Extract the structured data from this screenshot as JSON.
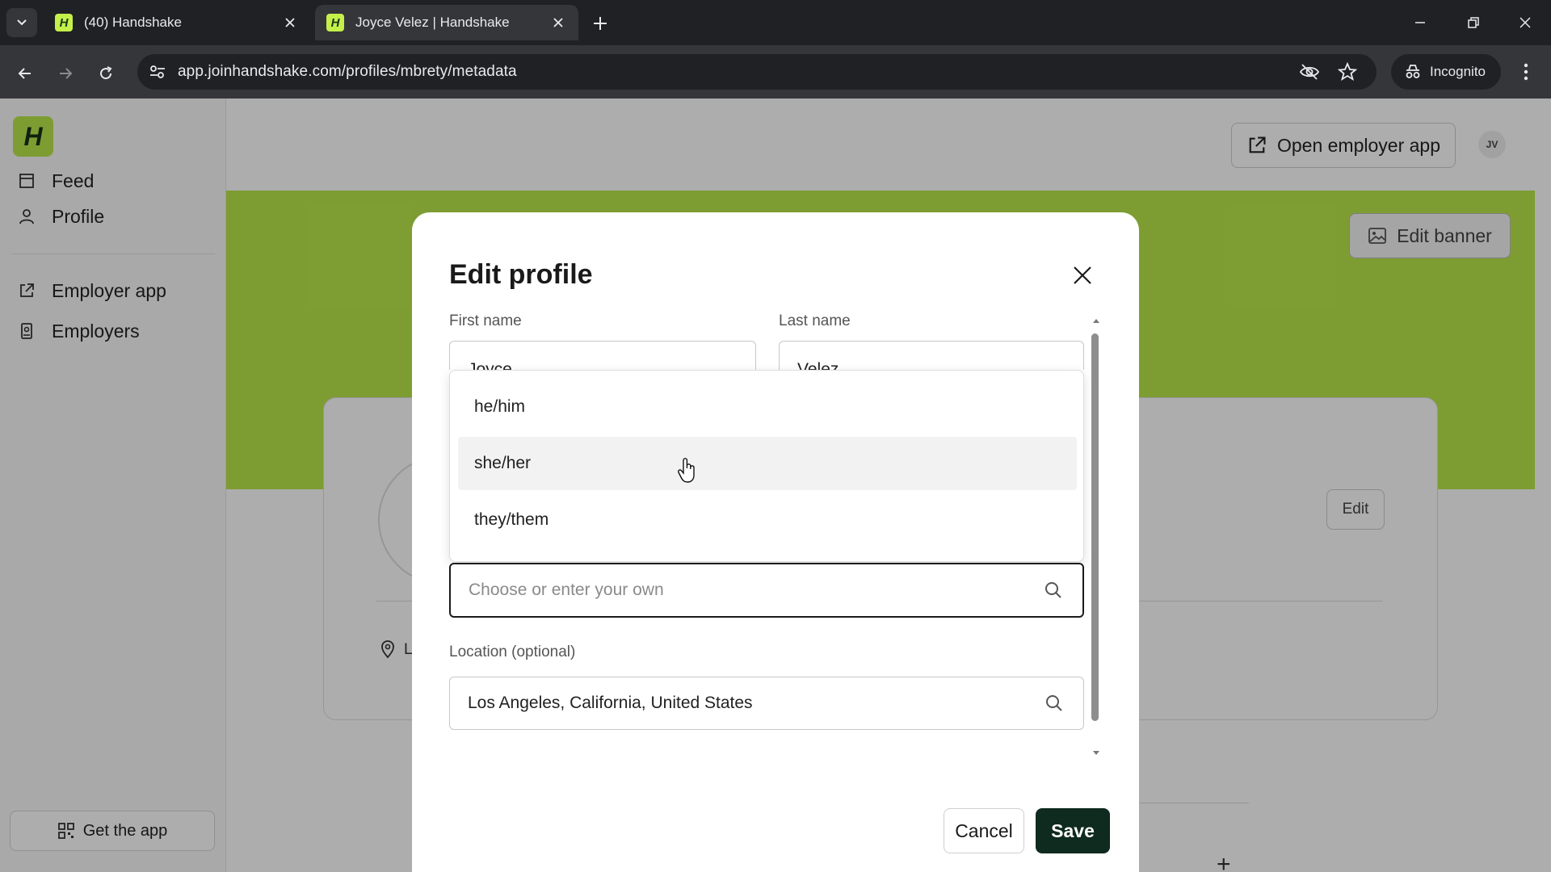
{
  "browser": {
    "tabs": [
      {
        "title": "(40) Handshake",
        "favicon": "H",
        "active": false
      },
      {
        "title": "Joyce Velez | Handshake",
        "favicon": "H",
        "active": true
      }
    ],
    "url": "app.joinhandshake.com/profiles/mbrety/metadata",
    "incognito_label": "Incognito",
    "colors": {
      "frame": "#202124",
      "toolbar": "#35363a",
      "text": "#e8eaed"
    }
  },
  "sidebar": {
    "logo": "H",
    "items": [
      {
        "label": "Feed",
        "icon": "feed-icon"
      },
      {
        "label": "Profile",
        "icon": "person-icon"
      },
      {
        "label": "Employer app",
        "icon": "external-link-icon"
      },
      {
        "label": "Employers",
        "icon": "badge-icon"
      }
    ],
    "get_app_label": "Get the app"
  },
  "header": {
    "open_employer_app": "Open employer app",
    "avatar_initials": "JV"
  },
  "profile_page": {
    "edit_banner": "Edit banner",
    "edit_button": "Edit",
    "location_initial": "L",
    "banner_color": "#b9e84a"
  },
  "modal": {
    "title": "Edit profile",
    "first_name": {
      "label": "First name",
      "value": "Joyce"
    },
    "last_name": {
      "label": "Last name",
      "value": "Velez"
    },
    "pronouns": {
      "placeholder": "Choose or enter your own",
      "options": [
        "he/him",
        "she/her",
        "they/them"
      ],
      "hovered": "she/her"
    },
    "location": {
      "label": "Location (optional)",
      "value": "Los Angeles, California, United States"
    },
    "cancel": "Cancel",
    "save": "Save",
    "colors": {
      "save_bg": "#0f2a1e"
    }
  }
}
